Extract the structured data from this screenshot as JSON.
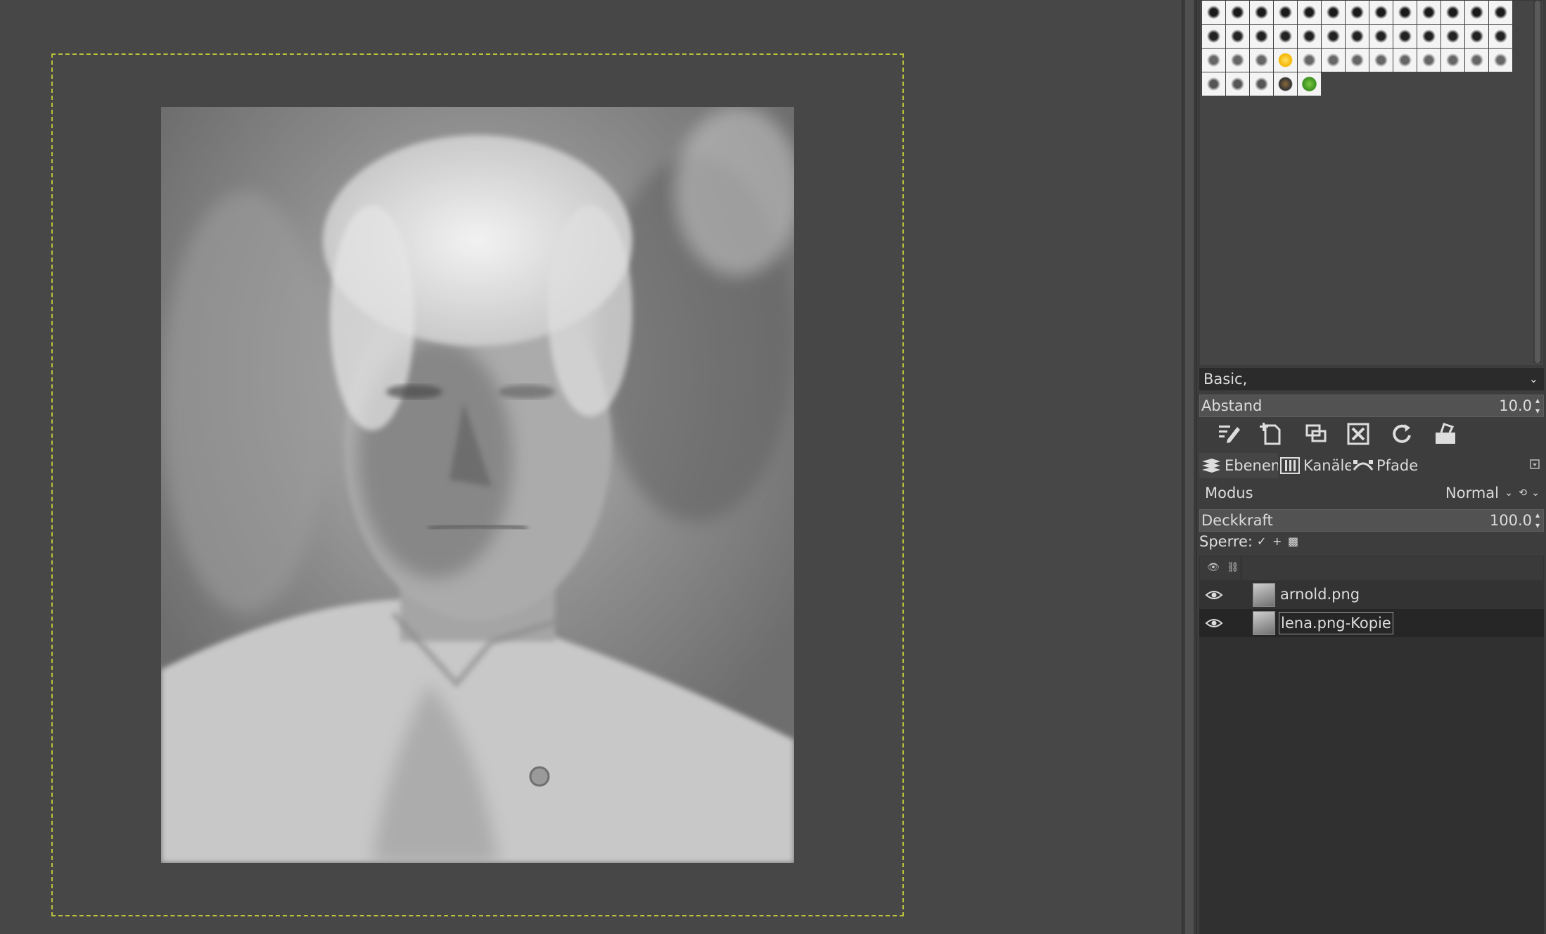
{
  "brushes": {
    "preset": "Basic,",
    "spacing_label": "Abstand",
    "spacing_value": "10.0"
  },
  "brush_actions": [
    {
      "name": "edit-brush-icon"
    },
    {
      "name": "new-brush-icon"
    },
    {
      "name": "duplicate-brush-icon"
    },
    {
      "name": "delete-brush-icon"
    },
    {
      "name": "refresh-brushes-icon"
    },
    {
      "name": "open-brush-folder-icon"
    }
  ],
  "tabs": [
    {
      "label": "Ebenen",
      "icon": "layers-icon"
    },
    {
      "label": "Kanäle",
      "icon": "channels-icon"
    },
    {
      "label": "Pfade",
      "icon": "paths-icon"
    }
  ],
  "layers": {
    "mode_label": "Modus",
    "mode_value": "Normal",
    "opacity_label": "Deckkraft",
    "opacity_value": "100.0",
    "lock_label": "Sperre:",
    "lock_icons": [
      "✓",
      "+",
      "▩"
    ],
    "items": [
      {
        "name": "arnold.png",
        "visible": true,
        "selected": false
      },
      {
        "name": "lena.png-Kopie",
        "visible": true,
        "selected": true
      }
    ]
  },
  "colors": {
    "canvas_bg": "#474747",
    "layer_boundary": "#b8c23a",
    "dock_bg": "#3d3d3d",
    "selected_row": "#262626"
  }
}
